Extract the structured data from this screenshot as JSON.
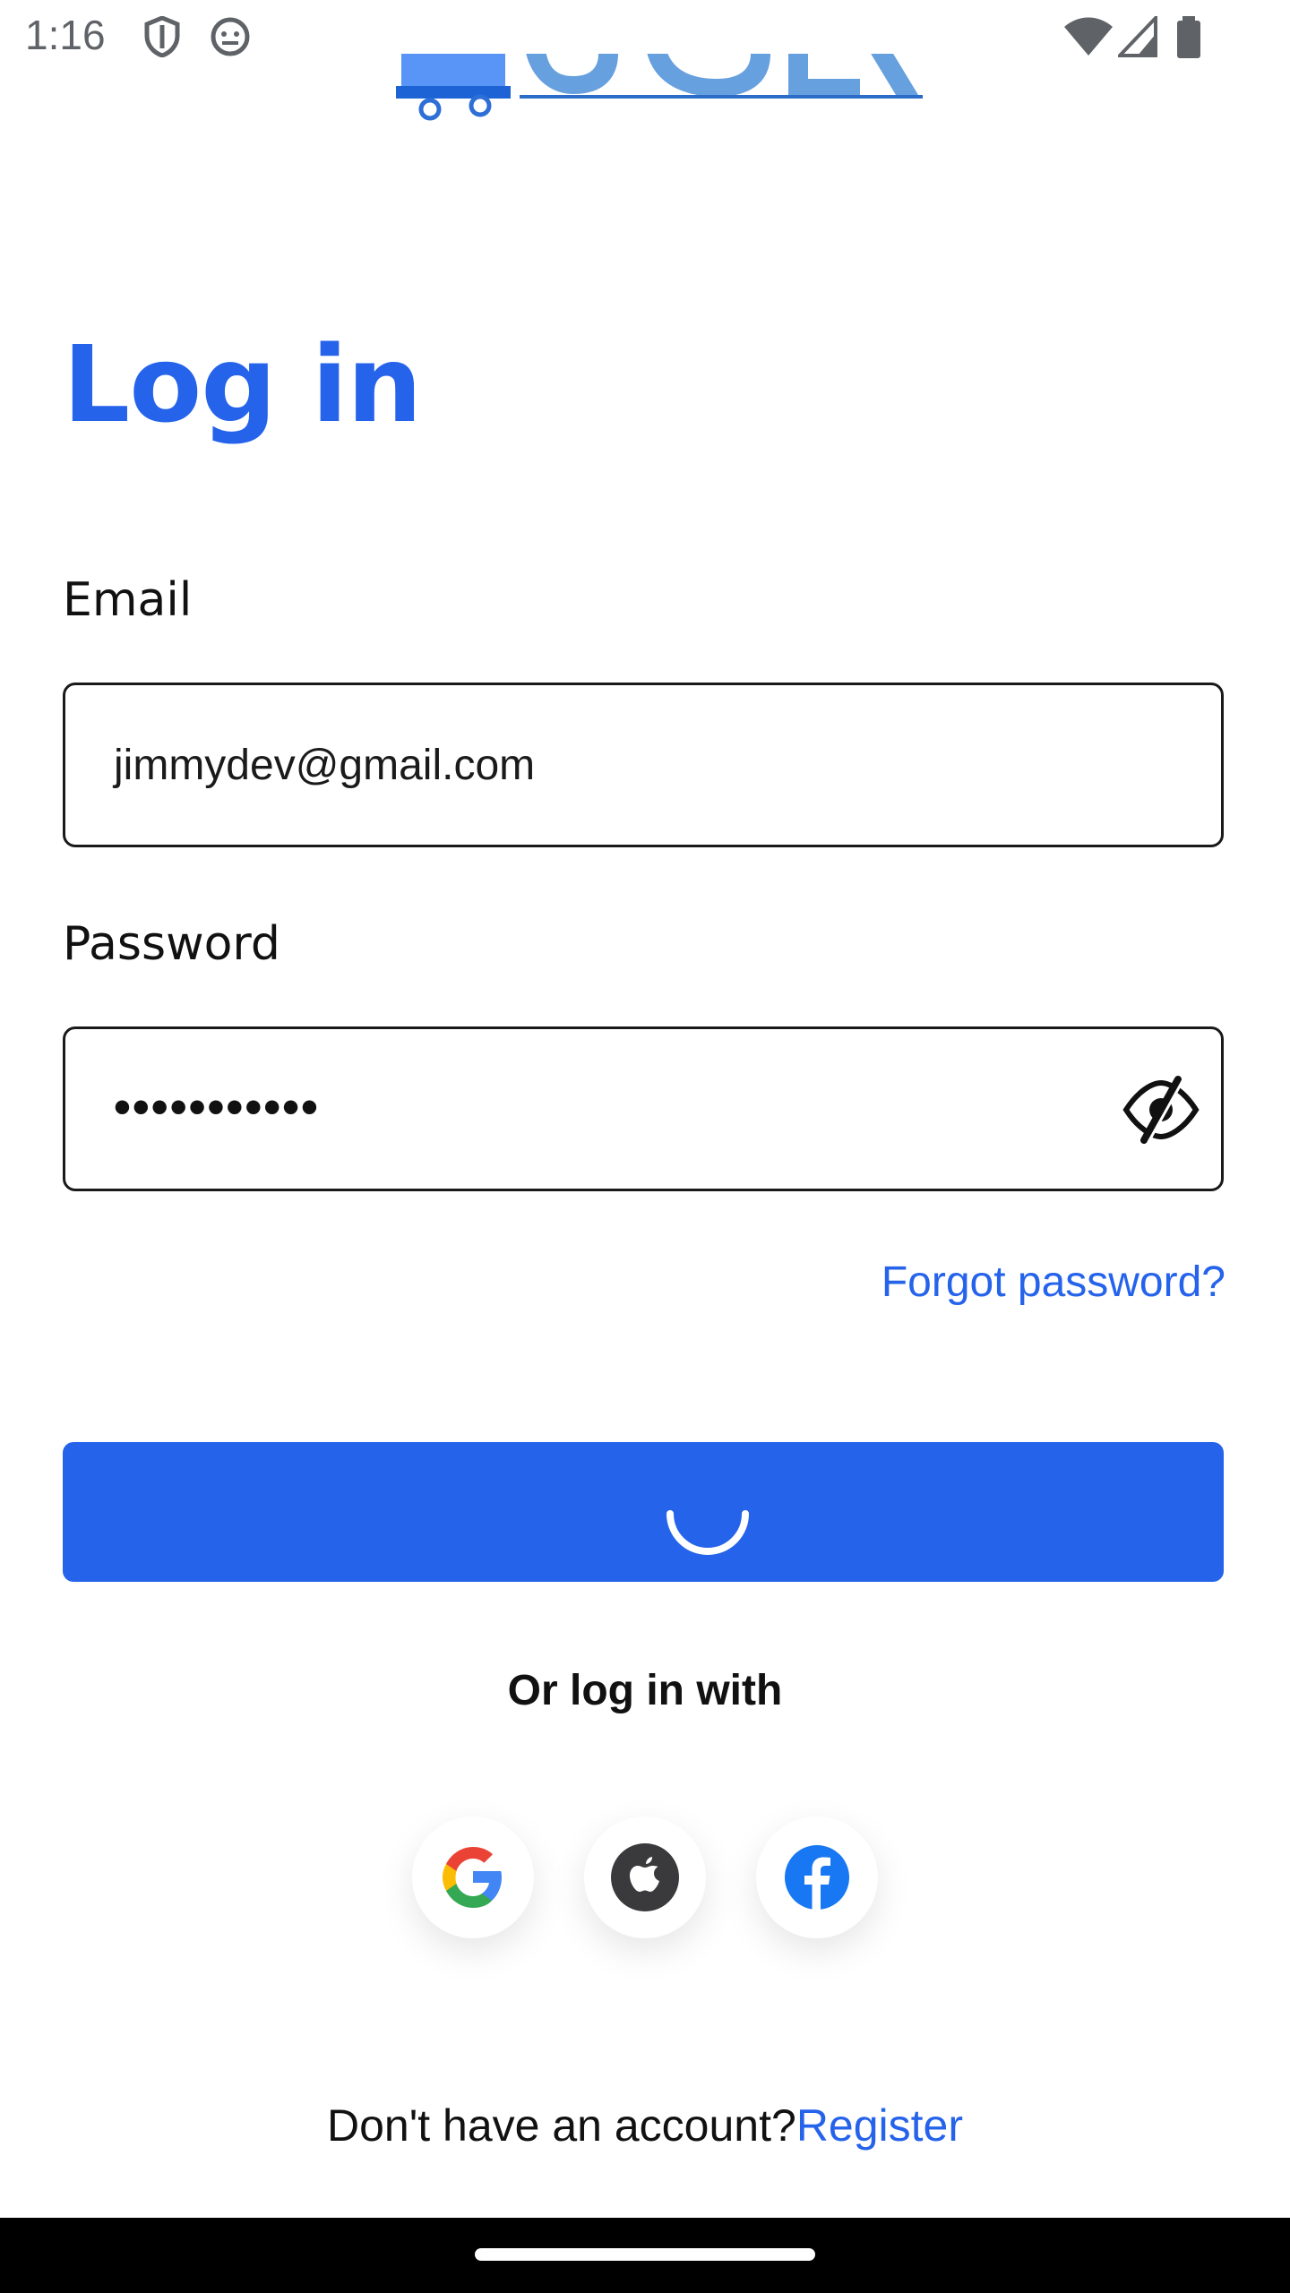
{
  "status_bar": {
    "time": "1:16"
  },
  "logo": {
    "icon": "cart-logo"
  },
  "page": {
    "title": "Log in"
  },
  "email": {
    "label": "Email",
    "value": "jimmydev@gmail.com"
  },
  "password": {
    "label": "Password",
    "masked_value": "•••••••••••"
  },
  "forgot_password": "Forgot password?",
  "login_button": {
    "state": "loading"
  },
  "social": {
    "caption": "Or log in with",
    "providers": [
      "google",
      "apple",
      "facebook"
    ]
  },
  "register": {
    "prompt": "Don't have an account?",
    "link": "Register"
  },
  "colors": {
    "accent": "#2563eb",
    "text": "#111111",
    "nav_bar": "#000000"
  }
}
